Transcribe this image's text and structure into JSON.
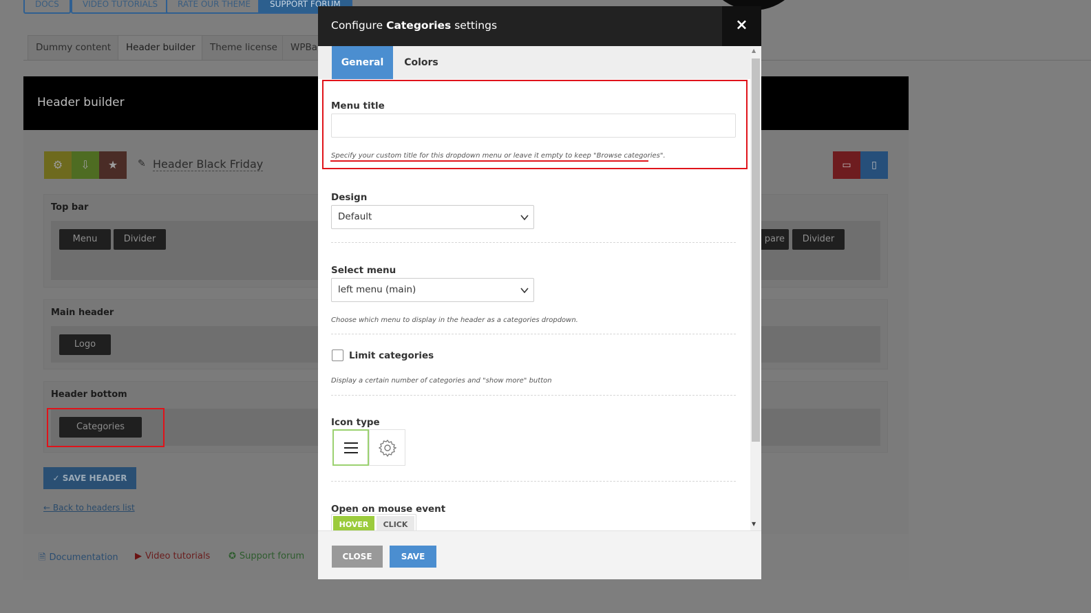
{
  "top_buttons": [
    "DOCS",
    "VIDEO TUTORIALS",
    "RATE OUR THEME",
    "SUPPORT FORUM"
  ],
  "bg_tabs": [
    "Dummy content",
    "Header builder",
    "Theme license",
    "WPBa"
  ],
  "header_builder": {
    "title": "Header builder",
    "header_name": "Header Black Friday",
    "rows": {
      "top_bar": {
        "title": "Top bar",
        "chips": [
          "Menu",
          "Divider"
        ],
        "right_chips": [
          "pare",
          "Divider"
        ]
      },
      "main_header": {
        "title": "Main header",
        "chips": [
          "Logo"
        ]
      },
      "header_bottom": {
        "title": "Header bottom",
        "chips": [
          "Categories"
        ]
      }
    },
    "save_button": "SAVE HEADER",
    "back_link": "← Back to headers list"
  },
  "footer_links": [
    "Documentation",
    "Video tutorials",
    "Support forum"
  ],
  "colors": {
    "modal_tab_active": "#4b8ed0",
    "highlight_red": "#e0131a",
    "hover_green": "#9bcb3c"
  },
  "modal": {
    "title_prefix": "Configure",
    "title_bold": "Categories",
    "title_suffix": "settings",
    "close_icon": "×",
    "tabs": [
      "General",
      "Colors"
    ],
    "menu_title": {
      "label": "Menu title",
      "value": "",
      "hint": "Specify your custom title for this dropdown menu or leave it empty to keep \"Browse categories\"."
    },
    "design": {
      "label": "Design",
      "value": "Default"
    },
    "select_menu": {
      "label": "Select menu",
      "value": "left menu (main)",
      "hint": "Choose which menu to display in the header as a categories dropdown."
    },
    "limit_categories": {
      "label": "Limit categories",
      "checked": false,
      "hint": "Display a certain number of categories and \"show more\" button"
    },
    "icon_type": {
      "label": "Icon type",
      "options": [
        "hamburger-icon",
        "gear-icon"
      ],
      "selected": "hamburger-icon"
    },
    "open_event": {
      "label": "Open on mouse event",
      "options": [
        "HOVER",
        "CLICK"
      ],
      "selected": "HOVER"
    },
    "buttons": {
      "close": "CLOSE",
      "save": "SAVE"
    }
  }
}
